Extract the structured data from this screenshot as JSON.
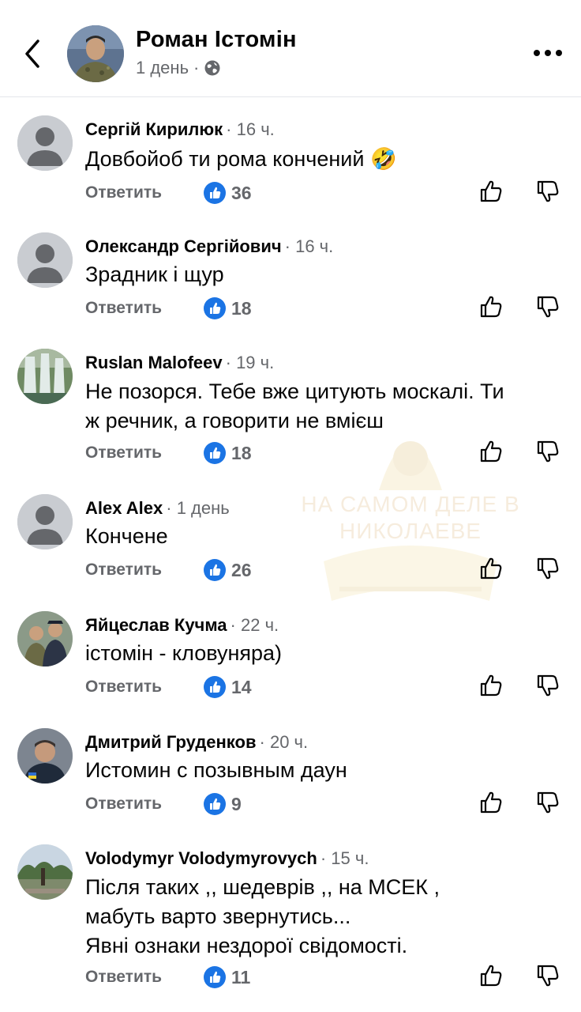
{
  "header": {
    "author": "Роман Істомін",
    "time": "1 день",
    "separator": "·",
    "audience_icon": "globe-icon"
  },
  "watermark": {
    "line1": "НА САМОМ ДЕЛЕ В",
    "line2": "НИКОЛАЕВЕ"
  },
  "comments": [
    {
      "name": "Сергій Кирилюк",
      "time": "16 ч.",
      "lines": [
        "Довбойоб ти рома кончений 🤣"
      ],
      "reply": "Ответить",
      "likes": "36",
      "avatar": "default-avatar"
    },
    {
      "name": "Олександр Сергійович",
      "time": "16 ч.",
      "lines": [
        "Зрадник і щур"
      ],
      "reply": "Ответить",
      "likes": "18",
      "avatar": "default-avatar"
    },
    {
      "name": "Ruslan Malofeev",
      "time": "19 ч.",
      "lines": [
        "Не позорся. Тебе вже цитують москалі. Ти",
        "ж речник, а говорити не вмієш"
      ],
      "reply": "Ответить",
      "likes": "18",
      "avatar": "waterfall-photo"
    },
    {
      "name": "Alex Alex",
      "time": "1 день",
      "lines": [
        "Кончене"
      ],
      "reply": "Ответить",
      "likes": "26",
      "avatar": "default-avatar"
    },
    {
      "name": "Яйцеслав Кучма",
      "time": "22 ч.",
      "lines": [
        "істомін - кловуняра)"
      ],
      "reply": "Ответить",
      "likes": "14",
      "avatar": "people-photo"
    },
    {
      "name": "Дмитрий Груденков",
      "time": "20 ч.",
      "lines": [
        "Истомин с позывным даун"
      ],
      "reply": "Ответить",
      "likes": "9",
      "avatar": "man-photo"
    },
    {
      "name": "Volodymyr Volodymyrovych",
      "time": "15 ч.",
      "lines": [
        "Після таких ,, шедеврів ,, на МСЕК ,",
        "мабуть варто звернутись...",
        "Явні ознаки нездорої свідомості."
      ],
      "reply": "Ответить",
      "likes": "11",
      "avatar": "park-photo"
    }
  ],
  "colors": {
    "like_blue": "#1b74e4",
    "meta_gray": "#65676b",
    "divider": "#e4e6eb"
  }
}
